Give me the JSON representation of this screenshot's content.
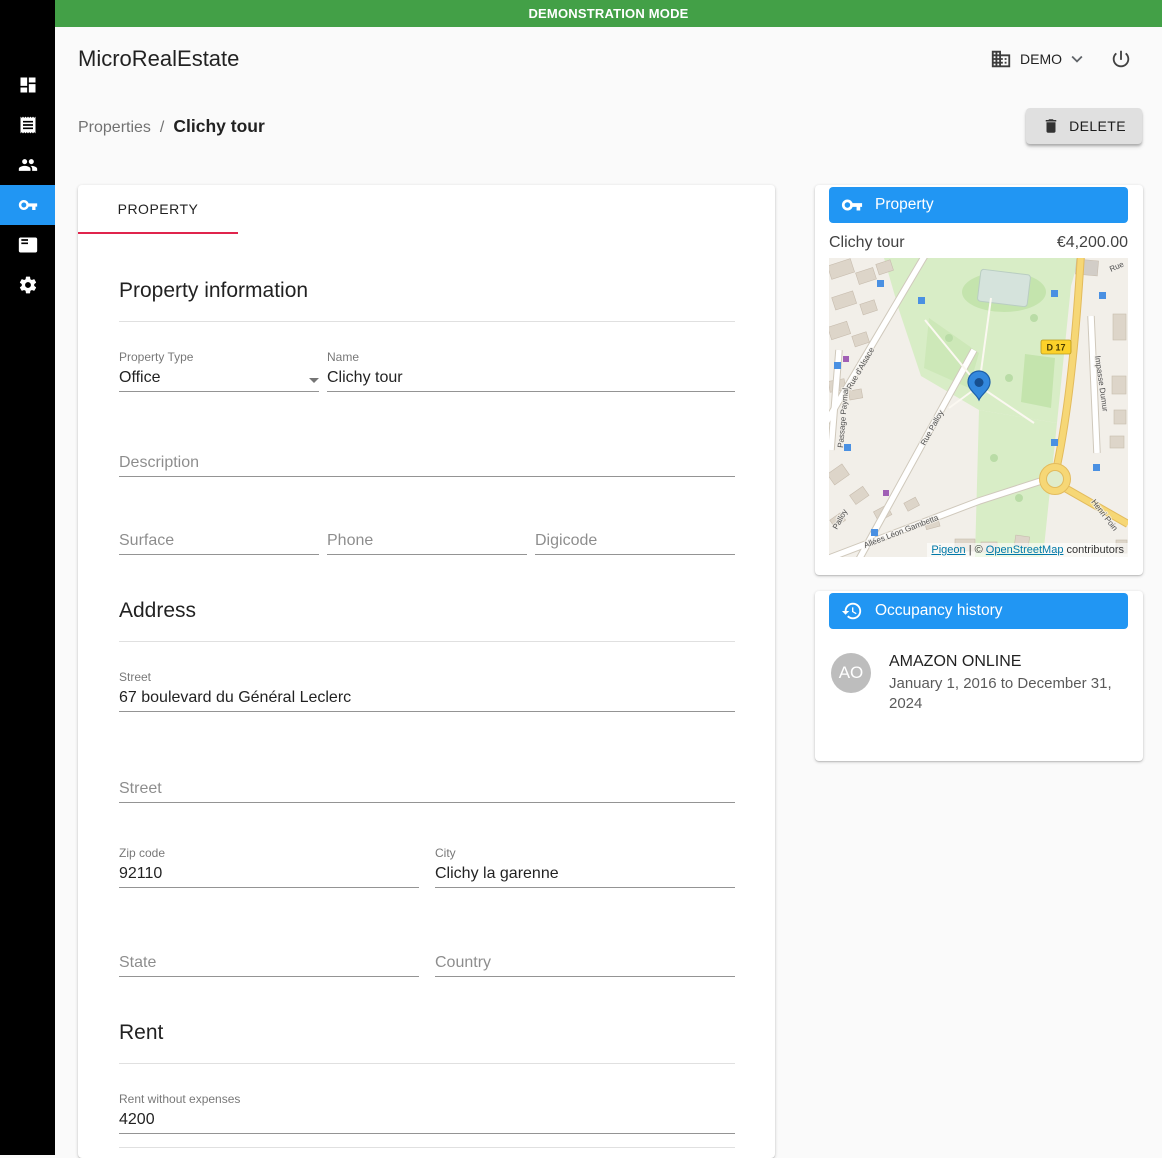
{
  "colors": {
    "banner": "#43a047",
    "accent": "#2196f3",
    "tab_indicator": "#e0244c",
    "sidebar_active": "#2196f3"
  },
  "banner": {
    "text": "DEMONSTRATION MODE"
  },
  "header": {
    "app_title": "MicroRealEstate",
    "org_name": "DEMO"
  },
  "breadcrumb": {
    "parent": "Properties",
    "separator": "/",
    "current": "Clichy tour"
  },
  "actions": {
    "delete_label": "DELETE"
  },
  "tabs": [
    {
      "label": "PROPERTY"
    }
  ],
  "sidebar": {
    "items": [
      {
        "icon": "dashboard-icon",
        "active": false
      },
      {
        "icon": "receipt-icon",
        "active": false
      },
      {
        "icon": "people-icon",
        "active": false
      },
      {
        "icon": "key-icon",
        "active": true
      },
      {
        "icon": "featured-list-icon",
        "active": false
      },
      {
        "icon": "settings-icon",
        "active": false
      }
    ]
  },
  "form": {
    "sections": {
      "property_info": "Property information",
      "address": "Address",
      "rent": "Rent"
    },
    "fields": {
      "property_type": {
        "label": "Property Type",
        "value": "Office"
      },
      "name": {
        "label": "Name",
        "value": "Clichy tour"
      },
      "description": {
        "label": "Description",
        "value": ""
      },
      "surface": {
        "label": "Surface",
        "value": ""
      },
      "phone": {
        "label": "Phone",
        "value": ""
      },
      "digicode": {
        "label": "Digicode",
        "value": ""
      },
      "street1": {
        "label": "Street",
        "value": "67 boulevard du Général Leclerc"
      },
      "street2": {
        "label": "Street",
        "value": ""
      },
      "zip_code": {
        "label": "Zip code",
        "value": "92110"
      },
      "city": {
        "label": "City",
        "value": "Clichy la garenne"
      },
      "state": {
        "label": "State",
        "value": ""
      },
      "country": {
        "label": "Country",
        "value": ""
      },
      "rent_without_expenses": {
        "label": "Rent without expenses",
        "value": "4200"
      }
    }
  },
  "property_card": {
    "header": "Property",
    "name": "Clichy tour",
    "rent": "€4,200.00",
    "map": {
      "road_badge": "D 17",
      "street_labels": {
        "alsace": "Rue d'Alsace",
        "palloy": "Rue Palloy",
        "palloy2": "Palloy",
        "gambetta": "Allées Léon Gambetta",
        "paymal": "Passage Paymal",
        "dumur": "Impasse Dumur",
        "henri": "Henri Poin",
        "rue": "Rue"
      },
      "attribution": {
        "pigeon_link": "Pigeon",
        "separator": "|",
        "copyright": "©",
        "osm_link": "OpenStreetMap",
        "contributors": "contributors"
      }
    }
  },
  "occupancy_card": {
    "header": "Occupancy history",
    "items": [
      {
        "avatar": "AO",
        "name": "AMAZON ONLINE",
        "period": "January 1, 2016 to December 31, 2024"
      }
    ]
  }
}
